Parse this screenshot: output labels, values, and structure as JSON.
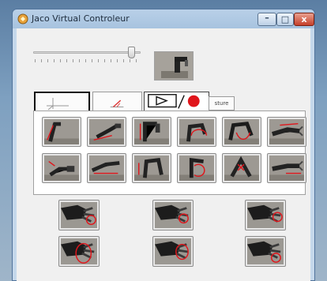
{
  "window": {
    "title": "Jaco Virtual Controleur",
    "minimize_glyph": "–",
    "maximize_glyph": "□",
    "close_glyph": "x"
  },
  "slider": {
    "level": 0.94
  },
  "tabs": [
    {
      "name": "axes-tab",
      "icon": "axes-icon"
    },
    {
      "name": "angle-tab",
      "icon": "angle-icon"
    },
    {
      "name": "record-tab",
      "icon": "play-record-icon"
    },
    {
      "name": "gesture-tab",
      "label": "sture"
    }
  ],
  "colors": {
    "accent_red": "#e0151b",
    "panel_bg": "#ffffff",
    "window_frame": "#a7c3df"
  },
  "movement_buttons": [
    "arm-translate-up",
    "arm-translate-left",
    "arm-translate-down",
    "wrist-rotate",
    "wrist-flex",
    "hand-translate-right",
    "arm-translate-back",
    "arm-translate-horizontal",
    "arm-lower",
    "wrist-rotate-reverse",
    "wrist-open",
    "hand-forward"
  ],
  "gripper_buttons": [
    "finger-1",
    "finger-2",
    "finger-3",
    "all-fingers",
    "two-fingers",
    "thumb"
  ]
}
